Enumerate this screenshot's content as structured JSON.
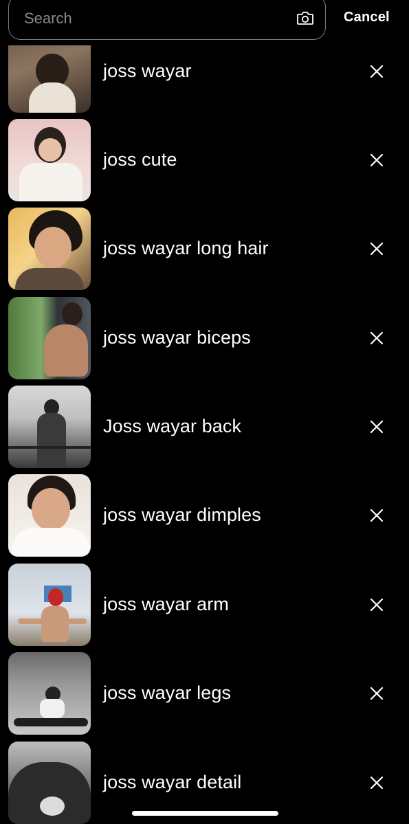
{
  "search": {
    "placeholder": "Search",
    "value": "",
    "camera_icon": "camera-icon",
    "cancel_label": "Cancel"
  },
  "recent_searches": [
    {
      "label": "joss wayar",
      "remove_icon": "close-icon"
    },
    {
      "label": "joss cute",
      "remove_icon": "close-icon"
    },
    {
      "label": "joss wayar long hair",
      "remove_icon": "close-icon"
    },
    {
      "label": "joss wayar biceps",
      "remove_icon": "close-icon"
    },
    {
      "label": "Joss wayar back",
      "remove_icon": "close-icon"
    },
    {
      "label": "joss wayar dimples",
      "remove_icon": "close-icon"
    },
    {
      "label": "joss wayar arm",
      "remove_icon": "close-icon"
    },
    {
      "label": "joss wayar legs",
      "remove_icon": "close-icon"
    },
    {
      "label": "joss wayar detail",
      "remove_icon": "close-icon"
    }
  ],
  "colors": {
    "background": "#000000",
    "text": "#ffffff",
    "placeholder": "#8a8a8a",
    "search_border": "#7a7a7a"
  }
}
